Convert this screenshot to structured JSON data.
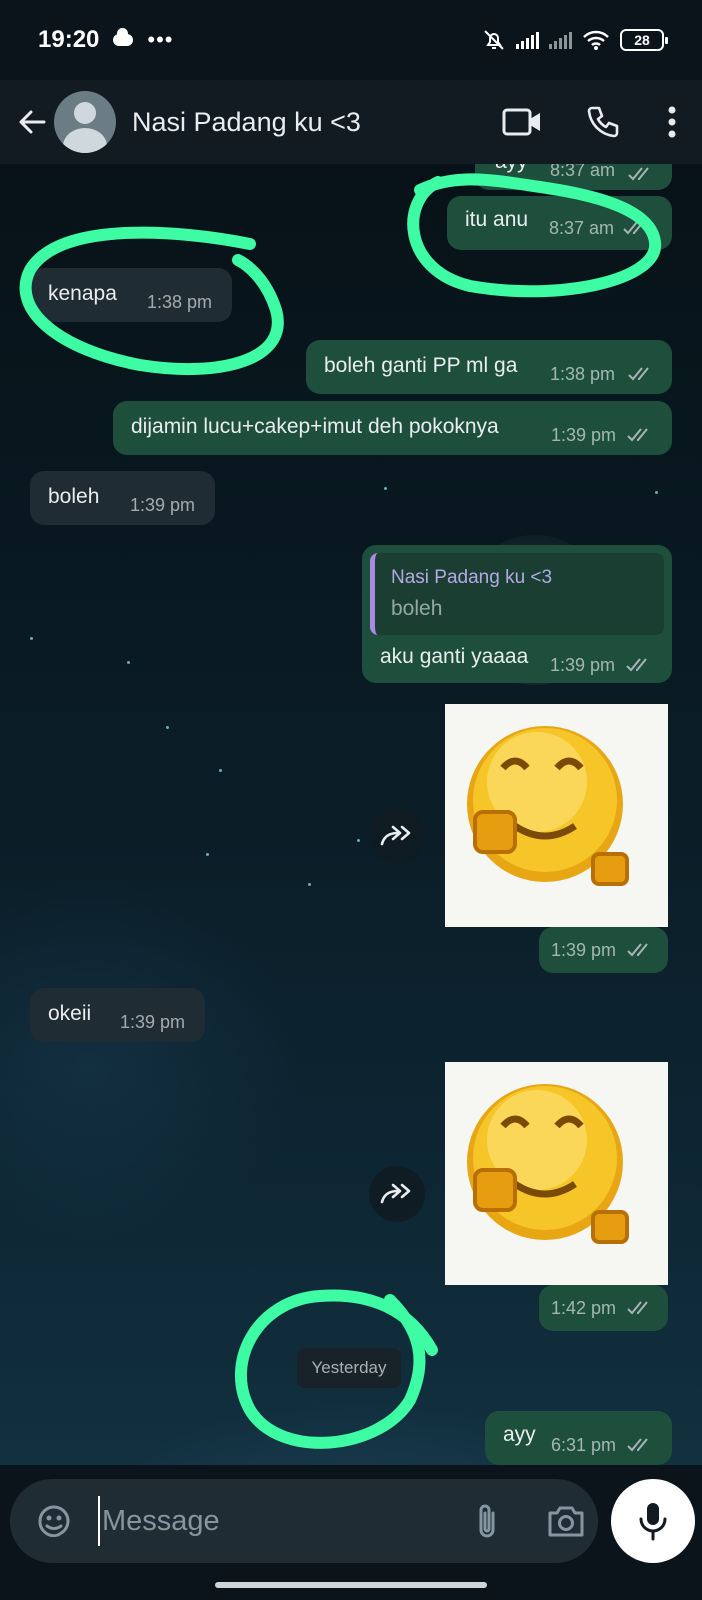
{
  "status_bar": {
    "time": "19:20",
    "dots": "•••",
    "battery": "28"
  },
  "header": {
    "contact_name": "Nasi Padang ku <3"
  },
  "messages": [
    {
      "direction": "out",
      "text": "ayy",
      "time": "8:37 am",
      "status": "read"
    },
    {
      "direction": "out",
      "text": "itu anu",
      "time": "8:37 am",
      "status": "read"
    },
    {
      "direction": "in",
      "text": "kenapa",
      "time": "1:38 pm"
    },
    {
      "direction": "out",
      "text": "boleh ganti PP ml ga",
      "time": "1:38 pm",
      "status": "read"
    },
    {
      "direction": "out",
      "text": "dijamin lucu+cakep+imut deh pokoknya",
      "time": "1:39 pm",
      "status": "read"
    },
    {
      "direction": "in",
      "text": "boleh",
      "time": "1:39 pm"
    },
    {
      "direction": "out",
      "text": "aku ganti yaaaa",
      "time": "1:39 pm",
      "status": "read",
      "reply_to": {
        "name": "Nasi Padang ku <3",
        "text": "boleh"
      }
    },
    {
      "direction": "out",
      "type": "sticker",
      "sticker": "smiling-pixel-emoji",
      "time": "1:39 pm",
      "status": "read"
    },
    {
      "direction": "in",
      "text": "okeii",
      "time": "1:39 pm"
    },
    {
      "direction": "out",
      "type": "sticker",
      "sticker": "smiling-pixel-emoji",
      "time": "1:42 pm",
      "status": "read"
    },
    {
      "direction": "out",
      "text": "ayy",
      "time": "6:31 pm",
      "status": "read"
    }
  ],
  "date_separator": "Yesterday",
  "composer": {
    "placeholder": "Message"
  },
  "colors": {
    "outgoing_bubble": "#1d4f3c",
    "incoming_bubble": "#202c33",
    "read_ticks": "#a8b3b8",
    "annotation_highlight": "#3dfca3"
  },
  "icons": [
    "back-arrow-icon",
    "video-call-icon",
    "phone-icon",
    "more-vert-icon",
    "forward-icon",
    "sticker-icon",
    "paperclip-icon",
    "camera-icon",
    "mic-icon"
  ]
}
